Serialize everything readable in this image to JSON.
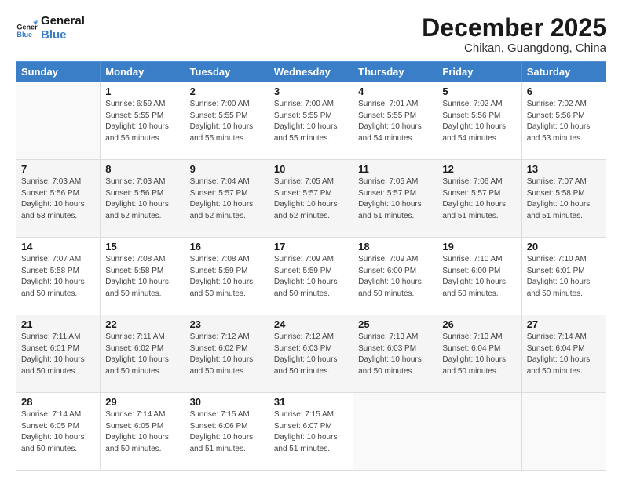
{
  "logo": {
    "line1": "General",
    "line2": "Blue"
  },
  "title": "December 2025",
  "subtitle": "Chikan, Guangdong, China",
  "headers": [
    "Sunday",
    "Monday",
    "Tuesday",
    "Wednesday",
    "Thursday",
    "Friday",
    "Saturday"
  ],
  "weeks": [
    [
      {
        "num": "",
        "info": ""
      },
      {
        "num": "1",
        "info": "Sunrise: 6:59 AM\nSunset: 5:55 PM\nDaylight: 10 hours\nand 56 minutes."
      },
      {
        "num": "2",
        "info": "Sunrise: 7:00 AM\nSunset: 5:55 PM\nDaylight: 10 hours\nand 55 minutes."
      },
      {
        "num": "3",
        "info": "Sunrise: 7:00 AM\nSunset: 5:55 PM\nDaylight: 10 hours\nand 55 minutes."
      },
      {
        "num": "4",
        "info": "Sunrise: 7:01 AM\nSunset: 5:55 PM\nDaylight: 10 hours\nand 54 minutes."
      },
      {
        "num": "5",
        "info": "Sunrise: 7:02 AM\nSunset: 5:56 PM\nDaylight: 10 hours\nand 54 minutes."
      },
      {
        "num": "6",
        "info": "Sunrise: 7:02 AM\nSunset: 5:56 PM\nDaylight: 10 hours\nand 53 minutes."
      }
    ],
    [
      {
        "num": "7",
        "info": "Sunrise: 7:03 AM\nSunset: 5:56 PM\nDaylight: 10 hours\nand 53 minutes."
      },
      {
        "num": "8",
        "info": "Sunrise: 7:03 AM\nSunset: 5:56 PM\nDaylight: 10 hours\nand 52 minutes."
      },
      {
        "num": "9",
        "info": "Sunrise: 7:04 AM\nSunset: 5:57 PM\nDaylight: 10 hours\nand 52 minutes."
      },
      {
        "num": "10",
        "info": "Sunrise: 7:05 AM\nSunset: 5:57 PM\nDaylight: 10 hours\nand 52 minutes."
      },
      {
        "num": "11",
        "info": "Sunrise: 7:05 AM\nSunset: 5:57 PM\nDaylight: 10 hours\nand 51 minutes."
      },
      {
        "num": "12",
        "info": "Sunrise: 7:06 AM\nSunset: 5:57 PM\nDaylight: 10 hours\nand 51 minutes."
      },
      {
        "num": "13",
        "info": "Sunrise: 7:07 AM\nSunset: 5:58 PM\nDaylight: 10 hours\nand 51 minutes."
      }
    ],
    [
      {
        "num": "14",
        "info": "Sunrise: 7:07 AM\nSunset: 5:58 PM\nDaylight: 10 hours\nand 50 minutes."
      },
      {
        "num": "15",
        "info": "Sunrise: 7:08 AM\nSunset: 5:58 PM\nDaylight: 10 hours\nand 50 minutes."
      },
      {
        "num": "16",
        "info": "Sunrise: 7:08 AM\nSunset: 5:59 PM\nDaylight: 10 hours\nand 50 minutes."
      },
      {
        "num": "17",
        "info": "Sunrise: 7:09 AM\nSunset: 5:59 PM\nDaylight: 10 hours\nand 50 minutes."
      },
      {
        "num": "18",
        "info": "Sunrise: 7:09 AM\nSunset: 6:00 PM\nDaylight: 10 hours\nand 50 minutes."
      },
      {
        "num": "19",
        "info": "Sunrise: 7:10 AM\nSunset: 6:00 PM\nDaylight: 10 hours\nand 50 minutes."
      },
      {
        "num": "20",
        "info": "Sunrise: 7:10 AM\nSunset: 6:01 PM\nDaylight: 10 hours\nand 50 minutes."
      }
    ],
    [
      {
        "num": "21",
        "info": "Sunrise: 7:11 AM\nSunset: 6:01 PM\nDaylight: 10 hours\nand 50 minutes."
      },
      {
        "num": "22",
        "info": "Sunrise: 7:11 AM\nSunset: 6:02 PM\nDaylight: 10 hours\nand 50 minutes."
      },
      {
        "num": "23",
        "info": "Sunrise: 7:12 AM\nSunset: 6:02 PM\nDaylight: 10 hours\nand 50 minutes."
      },
      {
        "num": "24",
        "info": "Sunrise: 7:12 AM\nSunset: 6:03 PM\nDaylight: 10 hours\nand 50 minutes."
      },
      {
        "num": "25",
        "info": "Sunrise: 7:13 AM\nSunset: 6:03 PM\nDaylight: 10 hours\nand 50 minutes."
      },
      {
        "num": "26",
        "info": "Sunrise: 7:13 AM\nSunset: 6:04 PM\nDaylight: 10 hours\nand 50 minutes."
      },
      {
        "num": "27",
        "info": "Sunrise: 7:14 AM\nSunset: 6:04 PM\nDaylight: 10 hours\nand 50 minutes."
      }
    ],
    [
      {
        "num": "28",
        "info": "Sunrise: 7:14 AM\nSunset: 6:05 PM\nDaylight: 10 hours\nand 50 minutes."
      },
      {
        "num": "29",
        "info": "Sunrise: 7:14 AM\nSunset: 6:05 PM\nDaylight: 10 hours\nand 50 minutes."
      },
      {
        "num": "30",
        "info": "Sunrise: 7:15 AM\nSunset: 6:06 PM\nDaylight: 10 hours\nand 51 minutes."
      },
      {
        "num": "31",
        "info": "Sunrise: 7:15 AM\nSunset: 6:07 PM\nDaylight: 10 hours\nand 51 minutes."
      },
      {
        "num": "",
        "info": ""
      },
      {
        "num": "",
        "info": ""
      },
      {
        "num": "",
        "info": ""
      }
    ]
  ]
}
